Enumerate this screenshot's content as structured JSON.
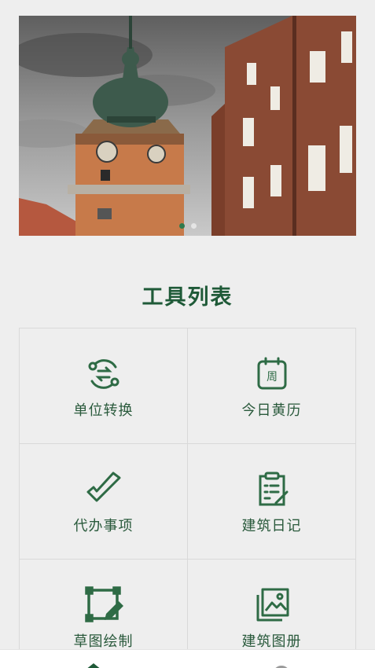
{
  "banner": {
    "slide_count": 2,
    "active_slide": 1
  },
  "tools": {
    "title": "工具列表",
    "items": [
      {
        "label": "单位转换",
        "icon": "unit-convert-icon"
      },
      {
        "label": "今日黄历",
        "icon": "calendar-icon"
      },
      {
        "label": "代办事项",
        "icon": "todo-check-icon"
      },
      {
        "label": "建筑日记",
        "icon": "clipboard-diary-icon"
      },
      {
        "label": "草图绘制",
        "icon": "sketch-draw-icon"
      },
      {
        "label": "建筑图册",
        "icon": "photo-album-icon"
      }
    ]
  },
  "calendar_icon_text": "周",
  "tabbar": {
    "items": [
      {
        "icon": "home-icon"
      },
      {
        "icon": "user-icon"
      }
    ]
  },
  "colors": {
    "accent": "#2e7a4e",
    "text": "#2a5a3c",
    "title": "#1f5a38"
  }
}
